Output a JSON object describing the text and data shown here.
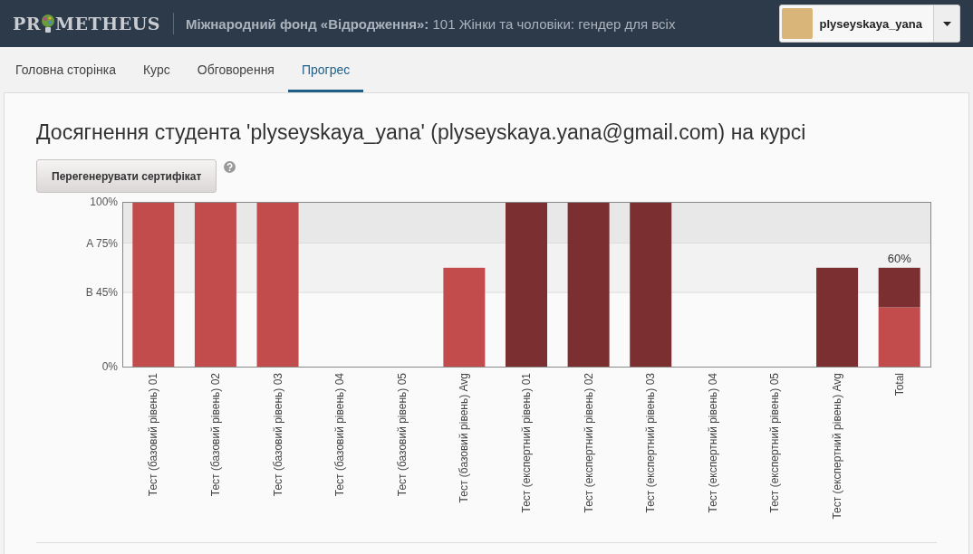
{
  "header": {
    "logo": {
      "before": "PR",
      "after": "METHEUS"
    },
    "course_title": "**Міжнародний фонд «Відродження»:** 101 Жінки та чоловіки: гендер для всіх",
    "user": {
      "username": "plyseyskaya_yana"
    }
  },
  "tabs": [
    {
      "label": "Головна сторінка",
      "selected": false
    },
    {
      "label": "Курс",
      "selected": false
    },
    {
      "label": "Обговорення",
      "selected": false
    },
    {
      "label": "Прогрес",
      "selected": true
    }
  ],
  "progress": {
    "heading": "Досягнення студента 'plyseyskaya_yana' (plyseyskaya.yana@gmail.com) на курсі",
    "regenerate_button": "Перегенерувати сертифікат",
    "chart_data": {
      "type": "bar",
      "stacked": true,
      "categories": [
        "Тест (базовий рівень) 01",
        "Тест (базовий рівень) 02",
        "Тест (базовий рівень) 03",
        "Тест (базовий рівень) 04",
        "Тест (базовий рівень) 05",
        "Тест (базовий рівень) Avg",
        "Тест (експертний рівень) 01",
        "Тест (експертний рівень) 02",
        "Тест (експертний рівень) 03",
        "Тест (експертний рівень) 04",
        "Тест (експертний рівень) 05",
        "Тест (експертний рівень) Avg",
        "Total"
      ],
      "series": [
        {
          "color": "#c24b4c",
          "values": [
            1,
            1,
            1,
            0,
            0,
            0.6,
            0,
            0,
            0,
            0,
            0,
            0,
            0.36
          ]
        },
        {
          "color": "#7b2f30",
          "values": [
            0,
            0,
            0,
            0,
            0,
            0,
            1,
            1,
            1,
            0,
            0,
            0.6,
            0.24
          ]
        }
      ],
      "ylim": [
        0,
        1
      ],
      "yticks": [
        {
          "value": 0,
          "label": "0%"
        },
        {
          "value": 0.45,
          "label": "B 45%"
        },
        {
          "value": 0.75,
          "label": "A 75%"
        },
        {
          "value": 1,
          "label": "100%"
        }
      ],
      "annotations": [
        {
          "x": "Total",
          "y": 0.6,
          "text": "60%"
        }
      ]
    }
  }
}
